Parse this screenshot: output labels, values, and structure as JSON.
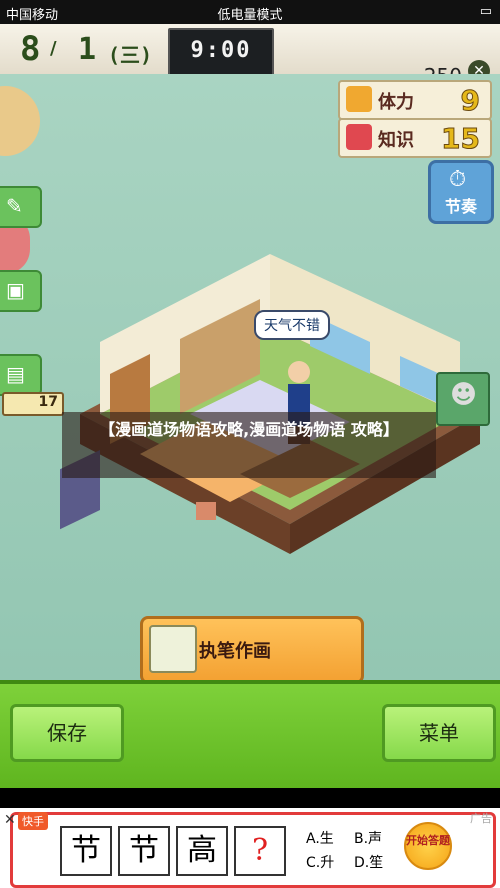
{
  "status_bar": {
    "carrier": "中国移动",
    "mode": "低电量模式"
  },
  "top_bar": {
    "month": "8",
    "day": "1",
    "weekday": "(三)",
    "time": "9:00",
    "money": "250"
  },
  "stats": [
    {
      "label": "体力",
      "value": "9",
      "icon": "stamina-icon",
      "color": "#f0a830"
    },
    {
      "label": "知识",
      "value": "15",
      "icon": "book-icon",
      "color": "#e04850"
    }
  ],
  "festival_button": {
    "label": "节奏"
  },
  "speech_bubble": "天气不错",
  "overlay_title": "【漫画道场物语攻略,漫画道场物语 攻略】",
  "count_badge": "17",
  "create_button": {
    "label": "执笔作画"
  },
  "bottom_bar": {
    "save_label": "保存",
    "menu_label": "菜单"
  },
  "ad": {
    "badge": "快手",
    "tag": "广告",
    "chars": [
      "节",
      "节",
      "高",
      "?"
    ],
    "options": [
      "A.生",
      "B.声",
      "C.升",
      "D.笙"
    ],
    "start": "开始答题"
  }
}
